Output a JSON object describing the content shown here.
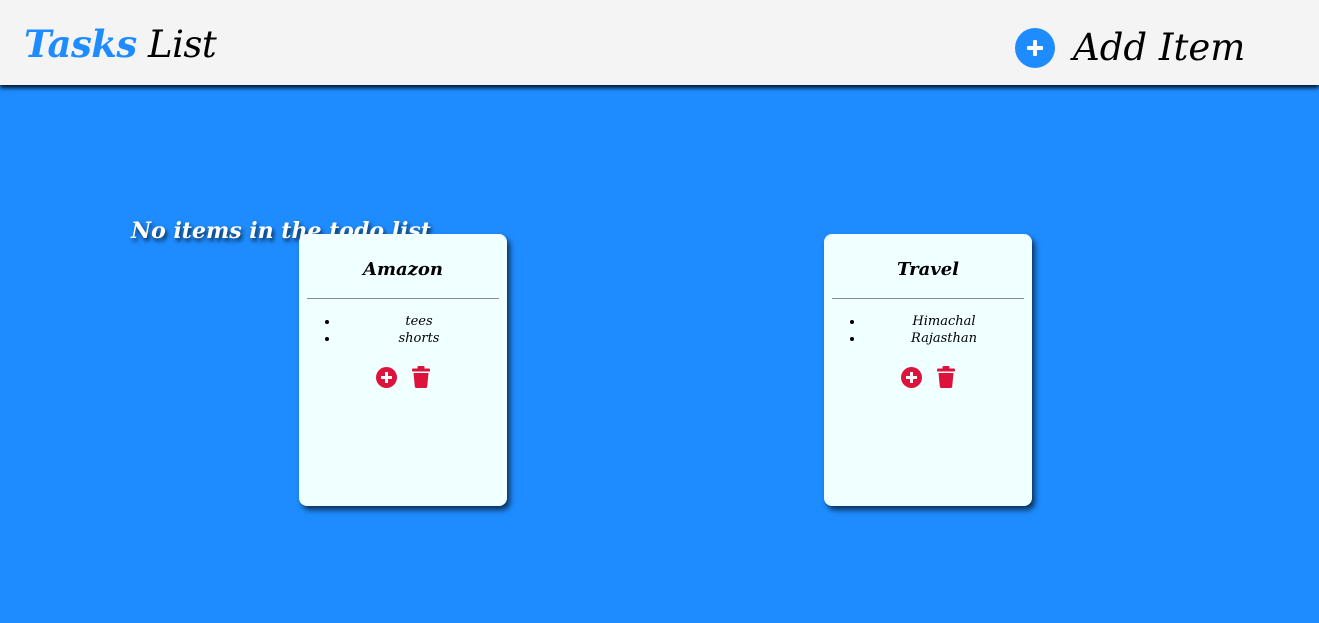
{
  "header": {
    "brand_word1": "Tasks",
    "brand_word2": "List",
    "add_item_label": "Add Item",
    "add_icon": "plus-circle-icon"
  },
  "empty_message": "No items in the todo list",
  "cards": [
    {
      "title": "Amazon",
      "items": [
        "tees",
        "shorts"
      ]
    },
    {
      "title": "Travel",
      "items": [
        "Himachal",
        "Rajasthan"
      ]
    }
  ],
  "colors": {
    "background": "#1e8cff",
    "header_bg": "#f4f4f4",
    "card_bg": "#f0ffff",
    "accent": "#1e8cff",
    "action_red": "#dc143c"
  }
}
